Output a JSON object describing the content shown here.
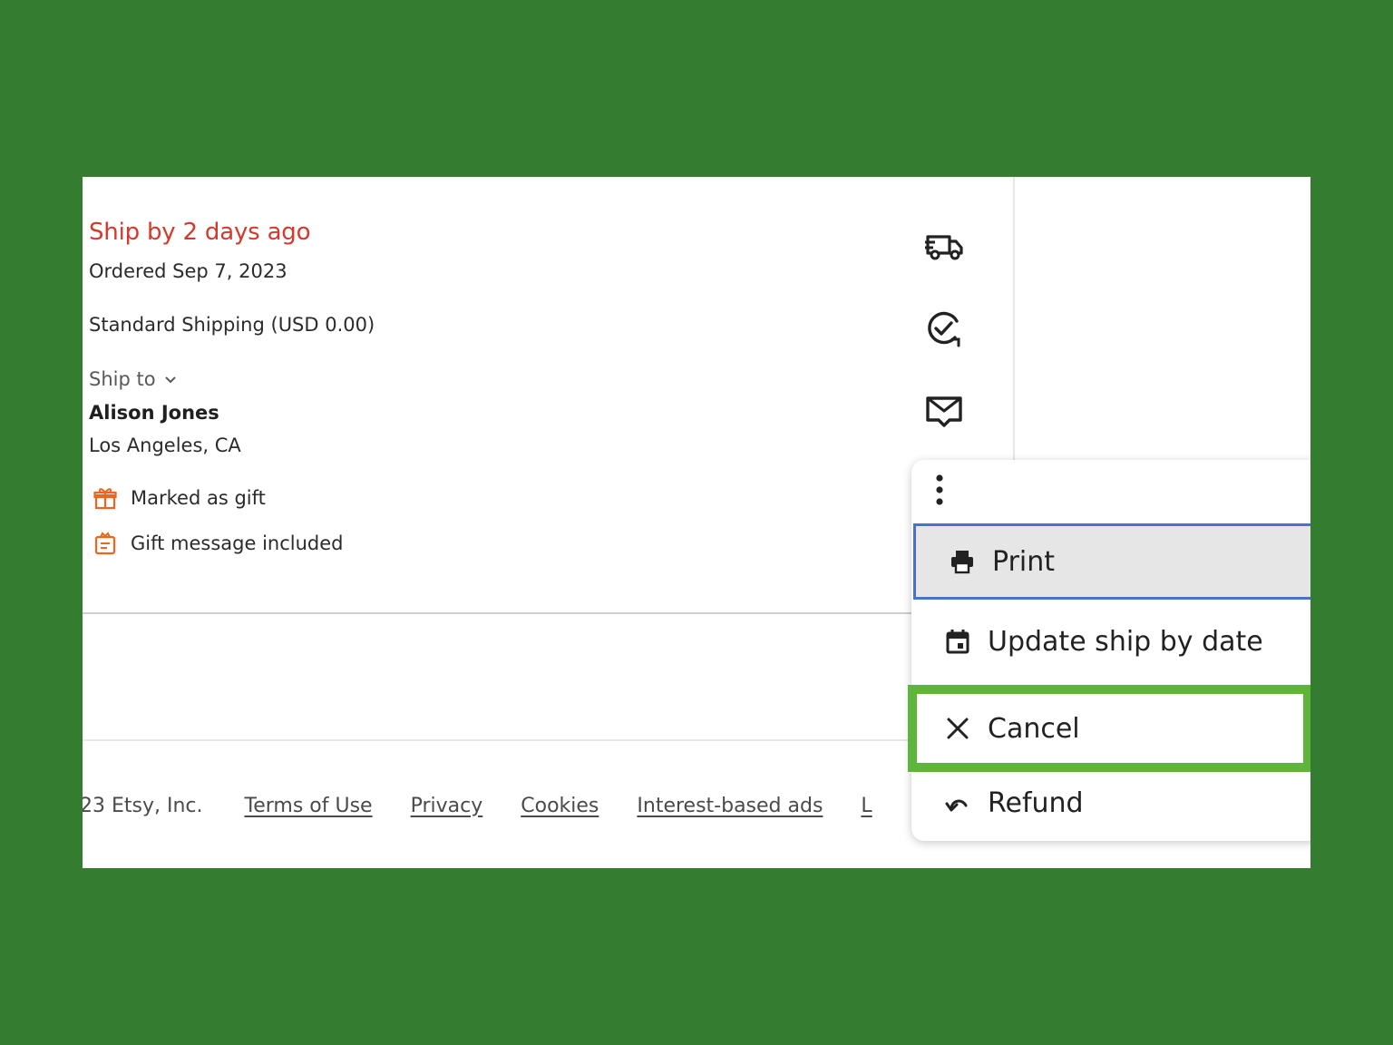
{
  "order": {
    "ship_by": "Ship by 2 days ago",
    "ordered": "Ordered Sep 7, 2023",
    "shipping": "Standard Shipping  (USD 0.00)",
    "ship_to_label": "Ship to",
    "recipient_name": "Alison Jones",
    "recipient_location": "Los Angeles, CA",
    "gift_marked": "Marked as gift",
    "gift_message": "Gift message included"
  },
  "actions": {
    "icons": [
      "delivery-truck-icon",
      "check-circle-icon",
      "message-envelope-icon",
      "more-options-icon"
    ]
  },
  "menu": {
    "items": [
      {
        "label": "Print",
        "icon": "printer-icon"
      },
      {
        "label": "Update ship by date",
        "icon": "calendar-icon"
      },
      {
        "label": "Cancel",
        "icon": "close-icon"
      },
      {
        "label": "Refund",
        "icon": "undo-arrow-icon"
      }
    ]
  },
  "footer": {
    "copyright": "23 Etsy, Inc.",
    "links": [
      "Terms of Use",
      "Privacy",
      "Cookies",
      "Interest-based ads",
      "L"
    ]
  },
  "colors": {
    "background": "#347c2f",
    "ship_by_red": "#d33a2c",
    "gift_orange": "#f1641e",
    "highlight_green": "#5fb43c",
    "focus_blue": "#4d6fd1"
  }
}
